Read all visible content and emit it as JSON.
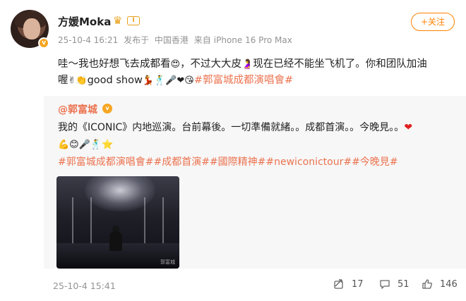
{
  "author": {
    "name": "方媛Moka",
    "level_badge": "Ⅰ",
    "verified_icon": "v",
    "crown_icon": "crown-icon"
  },
  "meta": {
    "time": "25-10-4 16:21",
    "published_from": "发布于",
    "location": "中国香港",
    "client_prefix": "来自",
    "client": "iPhone 16 Pro Max"
  },
  "follow_button": "+关注",
  "post": {
    "line1_a": "哇～我也好想飞去成都看",
    "line1_emoji": "😍",
    "line1_b": "，不过大大皮",
    "line1_emoji2": "🤰",
    "line1_c": "现在已经不能坐飞机了。你和团队加油",
    "line2_a": "喔",
    "line2_emojis": "✌👏",
    "line2_b": "good show",
    "line2_emojis2": "💃🕺🎤❤😘",
    "hashtag": "#郭富城成都演唱會#"
  },
  "repost": {
    "author": "@郭富城",
    "verified_icon": "v",
    "text": "我的《ICONIC》内地巡演。台前幕後。一切準備就緒。。成都首演。。今晚見。。",
    "heart": "❤",
    "emojis": "💪😊🎤🕺⭐",
    "hashtags": "#郭富城成都演唱會##成都首演##國際精神##newiconictour##今晚見#",
    "image_watermark": "郭富城"
  },
  "footer": {
    "time": "25-10-4 15:41",
    "repost_count": "17",
    "comment_count": "51",
    "like_count": "146"
  },
  "colors": {
    "accent": "#ff8200",
    "link": "#eb7350",
    "meta_gray": "#939393",
    "repost_bg": "#f7f7f7"
  }
}
